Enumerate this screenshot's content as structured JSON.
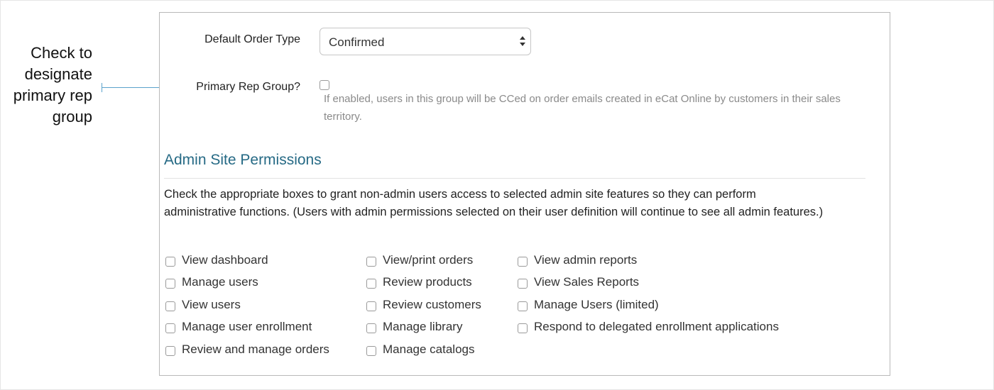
{
  "callout": {
    "lines": [
      "Check to",
      "designate",
      "primary rep",
      "group"
    ]
  },
  "form": {
    "default_order_type": {
      "label": "Default Order Type",
      "value": "Confirmed"
    },
    "primary_rep_group": {
      "label": "Primary Rep Group?",
      "checked": false,
      "help": "If enabled, users in this group will be CCed on order emails created in eCat Online by customers in their sales territory."
    }
  },
  "admin_permissions": {
    "title": "Admin Site Permissions",
    "description": "Check the appropriate boxes to grant non-admin users access to selected admin site features so they can perform administrative functions. (Users with admin permissions selected on their user definition will continue to see all admin features.)",
    "columns": [
      [
        {
          "label": "View dashboard",
          "checked": false
        },
        {
          "label": "Manage users",
          "checked": false
        },
        {
          "label": "View users",
          "checked": false
        },
        {
          "label": "Manage user enrollment",
          "checked": false
        },
        {
          "label": "Review and manage orders",
          "checked": false
        }
      ],
      [
        {
          "label": "View/print orders",
          "checked": false
        },
        {
          "label": "Review products",
          "checked": false
        },
        {
          "label": "Review customers",
          "checked": false
        },
        {
          "label": "Manage library",
          "checked": false
        },
        {
          "label": "Manage catalogs",
          "checked": false
        }
      ],
      [
        {
          "label": "View admin reports",
          "checked": false
        },
        {
          "label": "View Sales Reports",
          "checked": false
        },
        {
          "label": "Manage Users (limited)",
          "checked": false
        },
        {
          "label": "Respond to delegated enrollment applications",
          "checked": false
        }
      ]
    ]
  },
  "colors": {
    "section_title": "#266a85",
    "callout_line": "#5aa2cc",
    "help_text": "#8a8a8a"
  }
}
